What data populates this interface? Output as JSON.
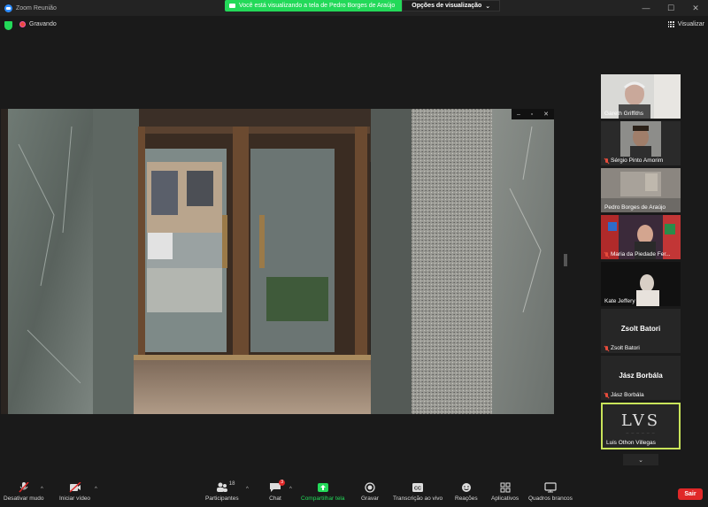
{
  "window": {
    "title": "Zoom Reunião",
    "controls": [
      "—",
      "☐",
      "✕"
    ]
  },
  "share_banner": {
    "message": "Você está visualizando a tela de Pedro Borges de Araújo",
    "options_label": "Opções de visualização",
    "options_caret": "⌄"
  },
  "status": {
    "recording_label": "Gravando",
    "view_label": "Visualizar"
  },
  "shared_window_controls": [
    "–",
    "▫",
    "✕"
  ],
  "participants": [
    {
      "name": "Gareth Griffiths",
      "muted": false,
      "type": "video",
      "active": false
    },
    {
      "name": "Sérgio Pinto Amorim",
      "muted": true,
      "type": "video",
      "active": false
    },
    {
      "name": "Pedro Borges de Araújo",
      "muted": false,
      "type": "video",
      "active": false
    },
    {
      "name": "Maria da Piedade Fer...",
      "muted": true,
      "type": "video",
      "active": false
    },
    {
      "name": "Kate Jeffery",
      "muted": false,
      "type": "video",
      "active": false
    },
    {
      "name": "Zsolt Batori",
      "display_name": "Zsolt Batori",
      "muted": true,
      "type": "name",
      "active": false
    },
    {
      "name": "Jász Borbála",
      "display_name": "Jász Borbála",
      "muted": true,
      "type": "name",
      "active": false
    },
    {
      "name": "Luis Othon Villegas",
      "muted": false,
      "type": "logo",
      "logo_text": "LVS",
      "active": true
    }
  ],
  "gallery_more": "⌄",
  "toolbar": {
    "mute_label": "Desativar mudo",
    "video_label": "Iniciar vídeo",
    "participants_label": "Participantes",
    "participants_count": "18",
    "chat_label": "Chat",
    "chat_badge": "3",
    "share_label": "Compartilhar tela",
    "record_label": "Gravar",
    "transcription_label": "Transcrição ao vivo",
    "reactions_label": "Reações",
    "apps_label": "Aplicativos",
    "whiteboard_label": "Quadros brancos",
    "leave_label": "Sair",
    "cc_text": "CC",
    "caret": "^"
  },
  "colors": {
    "share_green": "#23d959",
    "leave_red": "#e02828",
    "active_speaker": "#c9e45a",
    "zoom_blue": "#2d8cff"
  }
}
